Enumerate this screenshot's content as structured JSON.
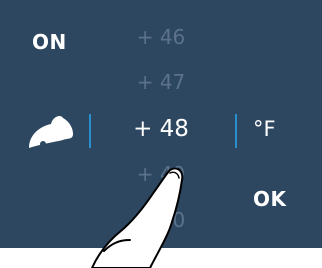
{
  "toggle": {
    "label": "ON"
  },
  "picker": {
    "values": [
      "+ 46",
      "+ 47",
      "+ 48",
      "+ 49",
      "+ 50"
    ],
    "selected_index": 2,
    "unit": "°F"
  },
  "confirm": {
    "label": "OK"
  },
  "icons": {
    "mode": "thermostat-mode-icon",
    "gesture": "pointing-hand-icon"
  },
  "colors": {
    "background": "#2e4760",
    "selected_text": "#ffffff",
    "dim_text": "#5b728a",
    "separator": "#2a8fcf"
  }
}
